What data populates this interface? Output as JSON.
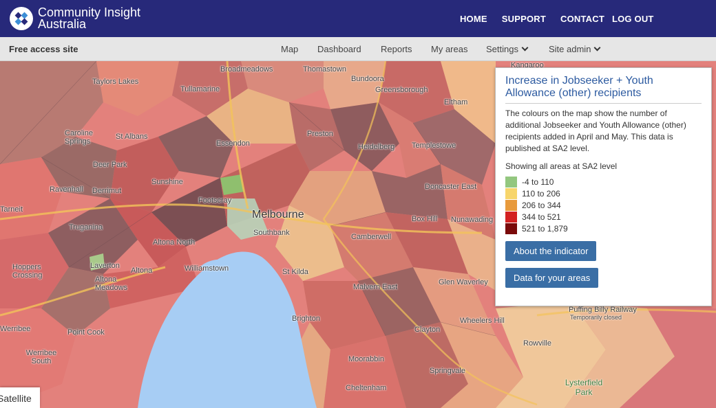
{
  "header": {
    "brand_line1": "Community Insight",
    "brand_line2": "Australia",
    "nav": [
      "HOME",
      "SUPPORT",
      "CONTACT",
      "LOG OUT"
    ]
  },
  "subbar": {
    "free_label": "Free access site",
    "items": [
      "Map",
      "Dashboard",
      "Reports",
      "My areas",
      "Settings",
      "Site admin"
    ]
  },
  "map": {
    "satellite_label": "Satellite",
    "labels": [
      "Taylors Lakes",
      "Tullamarine",
      "Broadmeadows",
      "Thomastown",
      "Bundoora",
      "Greensborough",
      "Eltham",
      "Caroline Springs",
      "St Albans",
      "Essendon",
      "Preston",
      "Heidelberg",
      "Templestowe",
      "Deer Park",
      "Sunshine",
      "Doncaster East",
      "Ravenhall",
      "Derrimut",
      "Footscray",
      "Melbourne",
      "Box Hill",
      "Nunawading",
      "Tarneit",
      "Truganina",
      "Southbank",
      "Camberwell",
      "Altona North",
      "Hoppers Crossing",
      "Laverton",
      "Altona",
      "Williamstown",
      "St Kilda",
      "Altona Meadows",
      "Malvern East",
      "Glen Waverley",
      "Werribee",
      "Point Cook",
      "Brighton",
      "Clayton",
      "Wheelers Hill",
      "Rowville",
      "Werribee South",
      "Moorabbin",
      "Springvale",
      "Cheltenham",
      "Kangaroo",
      "Puffing Billy Railway",
      "Temporarily closed",
      "Lysterfield Park"
    ]
  },
  "panel": {
    "title": "Increase in Jobseeker + Youth Allowance (other) recipients",
    "description": "The colours on the map show the number of additional Jobseeker and Youth Allowance (other) recipients added in April and May. This data is published at SA2 level.",
    "showing": "Showing all areas at SA2 level",
    "legend": [
      {
        "label": "-4 to 110",
        "color": "#93c77f"
      },
      {
        "label": "110 to 206",
        "color": "#f7d56b"
      },
      {
        "label": "206 to 344",
        "color": "#e89a3c"
      },
      {
        "label": "344 to 521",
        "color": "#d32121"
      },
      {
        "label": "521 to 1,879",
        "color": "#7a0a0a"
      }
    ],
    "button_indicator": "About the indicator",
    "button_data": "Data for your areas"
  }
}
